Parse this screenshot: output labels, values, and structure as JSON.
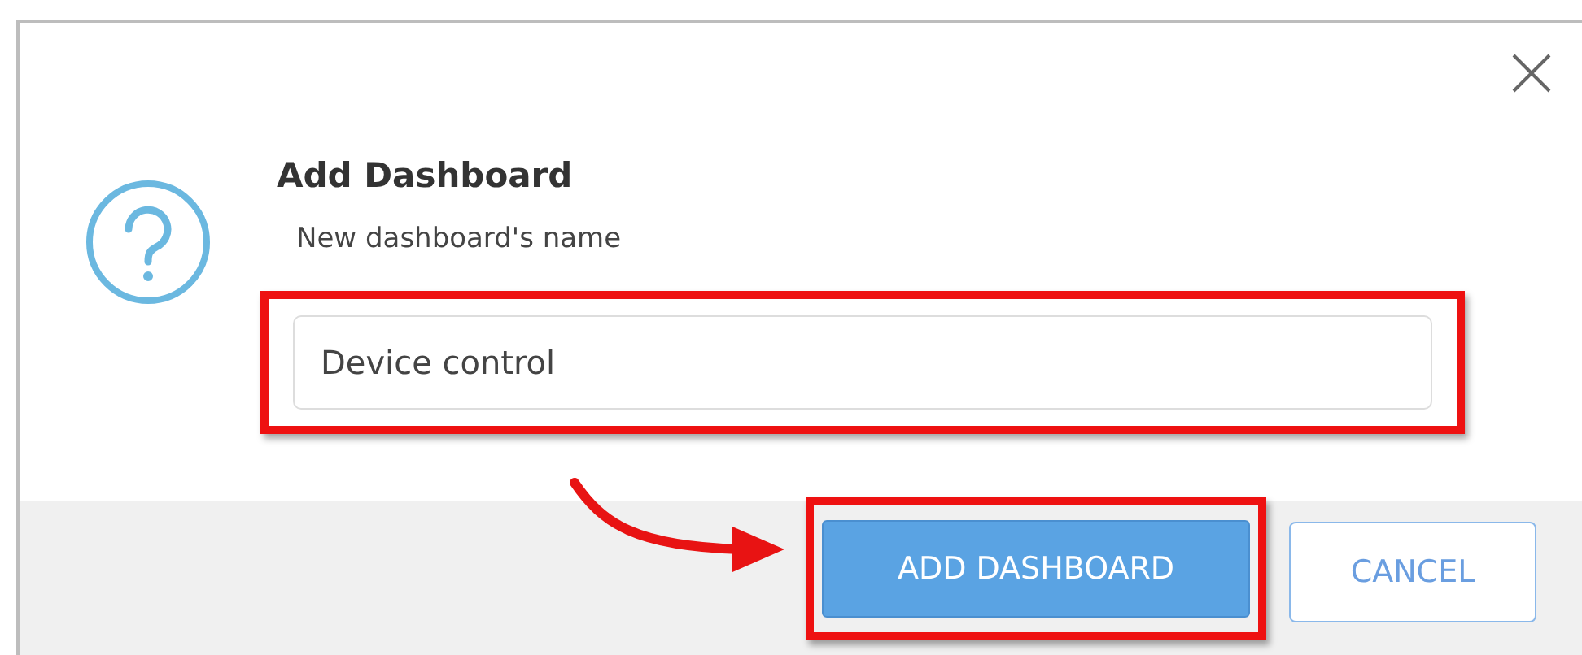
{
  "dialog": {
    "title": "Add Dashboard",
    "field": {
      "label": "New dashboard's name",
      "value": "Device control"
    },
    "buttons": [
      {
        "label": "ADD DASHBOARD",
        "kind": "primary"
      },
      {
        "label": "CANCEL",
        "kind": "secondary"
      }
    ]
  }
}
